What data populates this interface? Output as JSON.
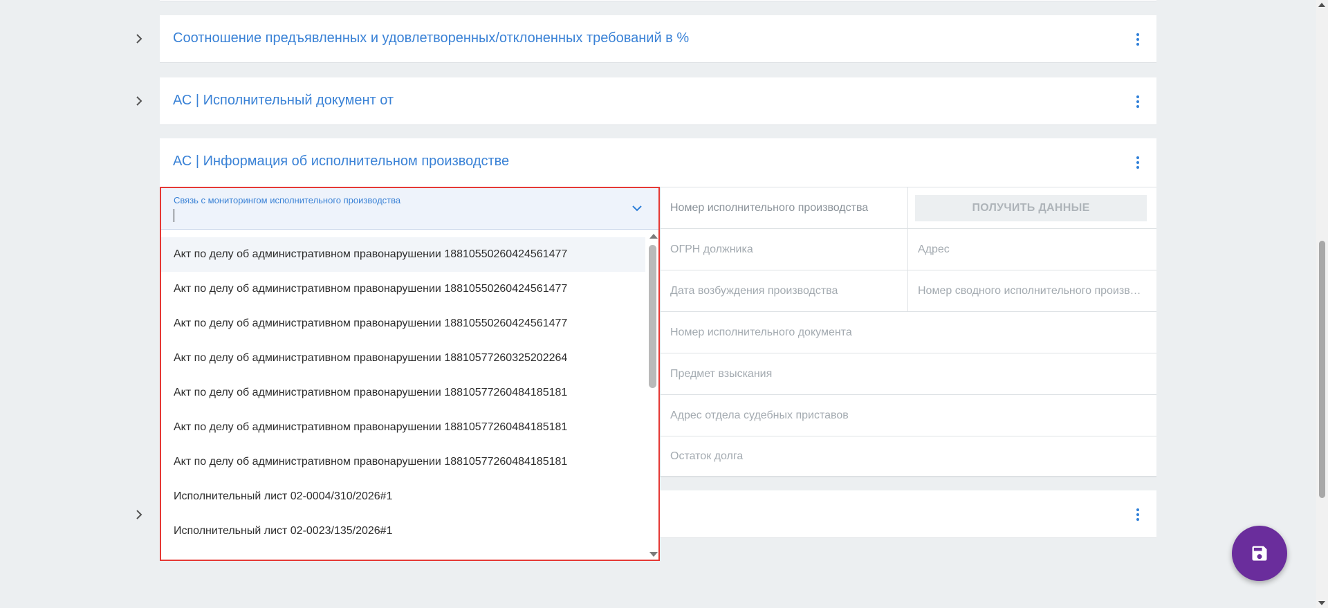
{
  "panels": [
    {
      "title": "Соотношение предъявленных и удовлетворенных/отклоненных требований в %"
    },
    {
      "title": "АС | Исполнительный документ от"
    },
    {
      "title": "АС | Информация об исполнительном производстве"
    },
    {
      "title": ""
    }
  ],
  "form": {
    "select": {
      "label": "Связь с мониторингом исполнительного производства",
      "value": "",
      "options": [
        "Акт по делу об административном правонарушении 18810550260424561477",
        "Акт по делу об административном правонарушении 18810550260424561477",
        "Акт по делу об административном правонарушении 18810550260424561477",
        "Акт по делу об административном правонарушении 18810577260325202264",
        "Акт по делу об административном правонарушении 18810577260484185181",
        "Акт по делу об административном правонарушении 18810577260484185181",
        "Акт по делу об административном правонарушении 18810577260484185181",
        "Исполнительный лист 02-0004/310/2026#1",
        "Исполнительный лист 02-0023/135/2026#1"
      ],
      "highlighted_index": 0
    },
    "fields": {
      "ep_number": "Номер исполнительного производства",
      "get_data_button": "ПОЛУЧИТЬ ДАННЫЕ",
      "debtor_ogrn": "ОГРН должника",
      "address": "Адрес",
      "start_date": "Дата возбуждения производства",
      "summary_ep_number": "Номер сводного исполнительного производства",
      "exec_doc_number": "Номер исполнительного документа",
      "subject": "Предмет взыскания",
      "bailiff_address": "Адрес отдела судебных приставов",
      "debt_remainder": "Остаток долга"
    }
  },
  "icons": {
    "expand": "chevron-right-icon",
    "menu": "more-vert-icon",
    "dropdown": "chevron-down-icon",
    "save": "save-icon"
  },
  "colors": {
    "accent": "#3a82d6",
    "fab": "#6a2d9c",
    "focus_border": "#e53935",
    "background": "#eceff1"
  }
}
